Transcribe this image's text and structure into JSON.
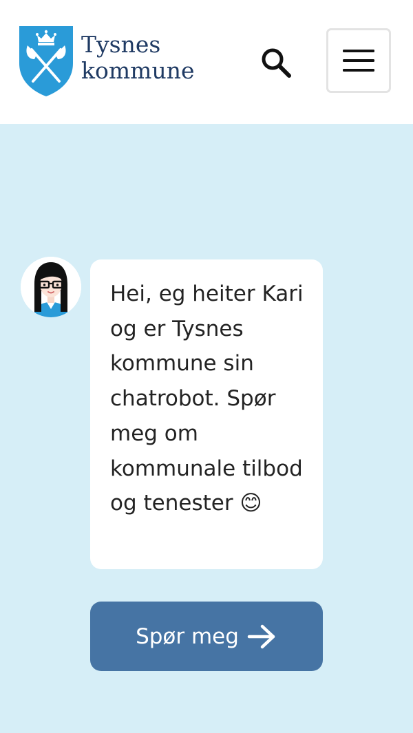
{
  "header": {
    "logo": {
      "line1": "Tysnes",
      "line2": "kommune"
    },
    "search_icon": "search-icon",
    "menu_icon": "hamburger-menu-icon"
  },
  "chat": {
    "avatar_icon": "chatbot-avatar-icon",
    "message": "Hei, eg heiter Kari og er Tysnes kommune sin chatrobot. Spør meg om kommunale tilbod og tenester 😊",
    "button_label": "Spør meg",
    "button_icon": "arrow-right-icon"
  },
  "colors": {
    "header_bg": "#ffffff",
    "main_bg": "#d6eef7",
    "crest_blue": "#2a9bd8",
    "logo_text": "#1f3a63",
    "button_bg": "#4674a4",
    "button_text": "#ffffff",
    "bubble_bg": "#ffffff",
    "bubble_text": "#232323"
  }
}
